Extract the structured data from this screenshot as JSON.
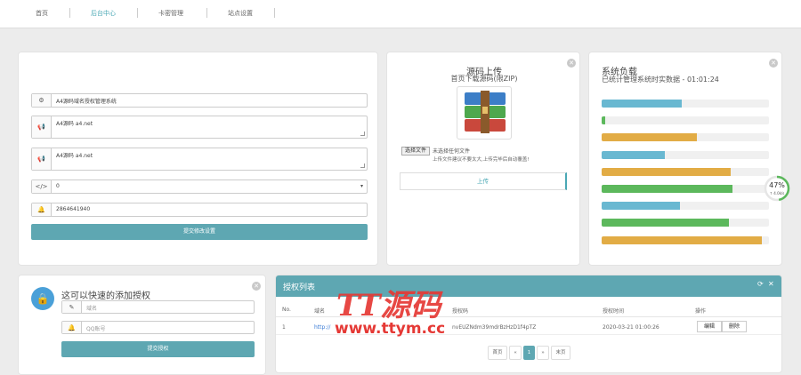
{
  "nav": {
    "items": [
      {
        "label": "首页"
      },
      {
        "label": "后台中心"
      },
      {
        "label": "卡密管理"
      },
      {
        "label": "站点设置"
      }
    ]
  },
  "form_panel": {
    "site_name": "A4源码域名授权管理系统",
    "desc1": "A4源码 a4.net",
    "desc2": "A4源码 a4.net",
    "select_value": "0",
    "qq": "2864641940",
    "submit_label": "提交修改设置"
  },
  "upload_panel": {
    "title": "源码上传",
    "subtitle": "首页下载源码(限ZIP)",
    "choose_file_label": "选择文件",
    "no_file_text": "未选择任何文件",
    "hint": "上传文件建议不要太大,上传完毕后自动覆盖!",
    "upload_label": "上传"
  },
  "load_panel": {
    "title": "系统负载",
    "subtitle": "已统计管理系统时实数据 - 01:01:24",
    "gauge_value": "47%",
    "gauge_percent": 47,
    "gauge_sub": "↑ 4.0k/s",
    "bars": [
      {
        "value": 0.48,
        "color": "#69b8d1"
      },
      {
        "value": 0.02,
        "color": "#5cb85c"
      },
      {
        "value": 0.57,
        "color": "#e2ac45"
      },
      {
        "value": 0.38,
        "color": "#69b8d1"
      },
      {
        "value": 0.77,
        "color": "#e2ac45"
      },
      {
        "value": 0.78,
        "color": "#5cb85c"
      },
      {
        "value": 0.47,
        "color": "#69b8d1"
      },
      {
        "value": 0.76,
        "color": "#5cb85c"
      },
      {
        "value": 0.96,
        "color": "#e2ac45"
      }
    ]
  },
  "quick_add": {
    "title": "这可以快速的添加授权",
    "domain_placeholder": "域名",
    "qq_placeholder": "QQ账号",
    "submit_label": "提交授权"
  },
  "auth_list": {
    "title": "授权列表",
    "headers": [
      "No.",
      "域名",
      "授权码",
      "授权时间",
      "操作"
    ],
    "rows": [
      {
        "no": "1",
        "domain": "http://",
        "code": "nvEUZNdm39mdrBzHzD1f4pTZ",
        "time": "2020-03-21 01:00:26",
        "edit": "编辑",
        "delete": "删除"
      }
    ],
    "pager": [
      "首页",
      "«",
      "1",
      "»",
      "末页"
    ]
  },
  "watermark": {
    "text1": "TT源码",
    "text2": "www.ttym.cc"
  }
}
